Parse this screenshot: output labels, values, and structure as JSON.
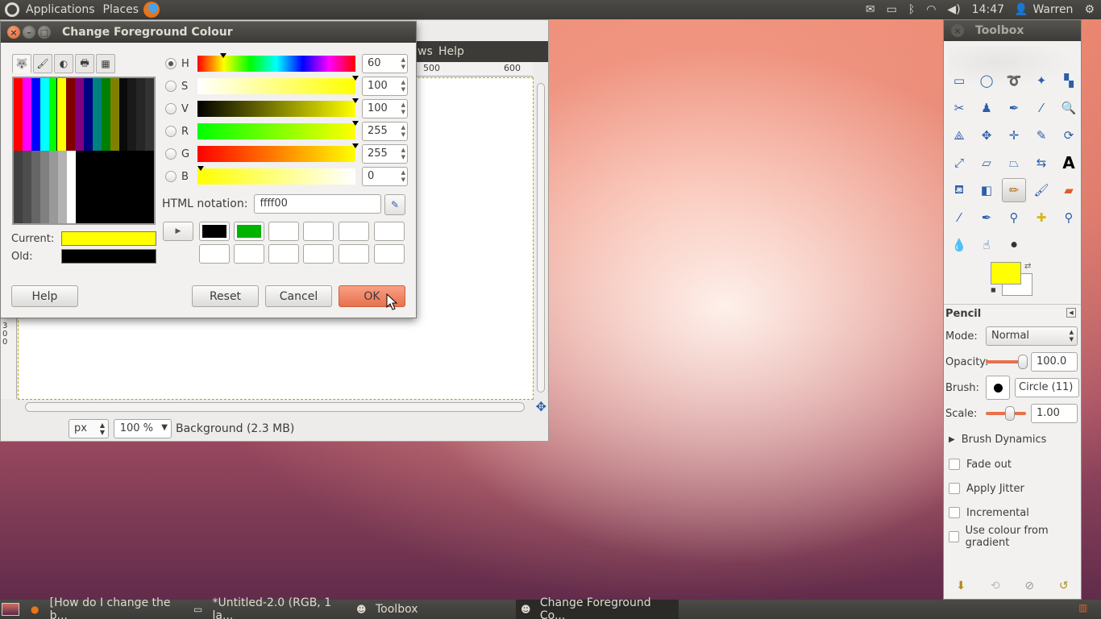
{
  "top_panel": {
    "menus": [
      "Applications",
      "Places"
    ],
    "clock": "14:47",
    "user": "Warren"
  },
  "image_window": {
    "menu_visible": [
      "ws",
      "Help"
    ],
    "ruler_h": [
      "500",
      "600"
    ],
    "ruler_v": "300",
    "unit": "px",
    "zoom": "100 %",
    "status": "Background (2.3 MB)"
  },
  "dialog": {
    "title": "Change Foreground Colour",
    "channels": [
      {
        "label": "H",
        "value": "60"
      },
      {
        "label": "S",
        "value": "100"
      },
      {
        "label": "V",
        "value": "100"
      },
      {
        "label": "R",
        "value": "255"
      },
      {
        "label": "G",
        "value": "255"
      },
      {
        "label": "B",
        "value": "0"
      }
    ],
    "html_notation_label": "HTML notation:",
    "html_notation_value": "ffff00",
    "current_label": "Current:",
    "old_label": "Old:",
    "current_color": "#ffff00",
    "old_color": "#000000",
    "history_colors": [
      "#000000",
      "#00b400",
      "#ffffff",
      "#ffffff",
      "#ffffff",
      "#ffffff",
      "#ffffff",
      "#ffffff",
      "#ffffff",
      "#ffffff",
      "#ffffff",
      "#ffffff"
    ],
    "buttons": {
      "help": "Help",
      "reset": "Reset",
      "cancel": "Cancel",
      "ok": "OK"
    }
  },
  "toolbox": {
    "title": "Toolbox",
    "fg_color": "#ffff00",
    "bg_color": "#ffffff",
    "tool_options_title": "Pencil",
    "mode_label": "Mode:",
    "mode_value": "Normal",
    "opacity_label": "Opacity:",
    "opacity_value": "100.0",
    "brush_label": "Brush:",
    "brush_value": "Circle (11)",
    "scale_label": "Scale:",
    "scale_value": "1.00",
    "brush_dynamics": "Brush Dynamics",
    "checkboxes": [
      "Fade out",
      "Apply Jitter",
      "Incremental",
      "Use colour from gradient"
    ]
  },
  "taskbar": {
    "tasks": [
      {
        "label": "[How do I change the b...",
        "icon": "firefox-icon"
      },
      {
        "label": "*Untitled-2.0 (RGB, 1 la...",
        "icon": "gimp-image-icon"
      },
      {
        "label": "Toolbox",
        "icon": "gimp-icon"
      },
      {
        "label": "Change Foreground Co...",
        "icon": "gimp-icon"
      }
    ]
  }
}
